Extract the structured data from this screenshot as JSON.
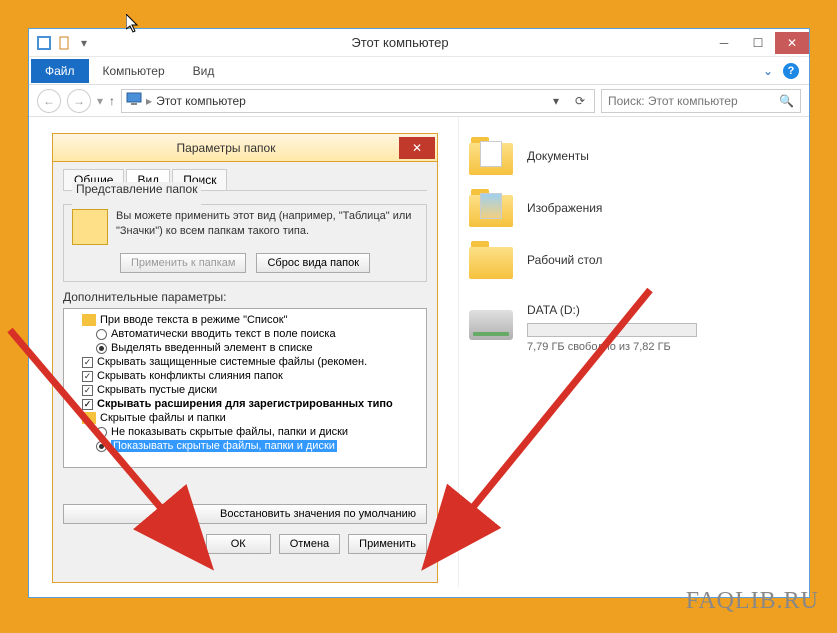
{
  "window": {
    "title": "Этот компьютер",
    "file_tab": "Файл",
    "computer_tab": "Компьютер",
    "view_tab": "Вид",
    "breadcrumb": "Этот компьютер",
    "search_placeholder": "Поиск: Этот компьютер"
  },
  "folders": {
    "documents": "Документы",
    "images": "Изображения",
    "desktop": "Рабочий стол"
  },
  "disk": {
    "name": "DATA (D:)",
    "status": "7,79 ГБ свободно из 7,82 ГБ"
  },
  "dialog": {
    "title": "Параметры папок",
    "tabs": {
      "general": "Общие",
      "view": "Вид",
      "search": "Поиск"
    },
    "group_title": "Представление папок",
    "group_text": "Вы можете применить этот вид (например, \"Таблица\" или \"Значки\") ко всем папкам такого типа.",
    "apply_folders": "Применить к папкам",
    "reset_folders": "Сброс вида папок",
    "adv_label": "Дополнительные параметры:",
    "tree": {
      "n1": "При вводе текста в режиме \"Список\"",
      "n1a": "Автоматически вводить текст в поле поиска",
      "n1b": "Выделять введенный элемент в списке",
      "n2": "Скрывать защищенные системные файлы (рекомен.",
      "n3": "Скрывать конфликты слияния папок",
      "n4": "Скрывать пустые диски",
      "n5": "Скрывать расширения для зарегистрированных типо",
      "n6": "Скрытые файлы и папки",
      "n6a": "Не показывать скрытые файлы, папки и диски",
      "n6b": "Показывать скрытые файлы, папки и диски"
    },
    "restore": "Восстановить значения по умолчанию",
    "ok": "ОК",
    "cancel": "Отмена",
    "apply": "Применить"
  },
  "watermark": "FAQLIB.RU"
}
